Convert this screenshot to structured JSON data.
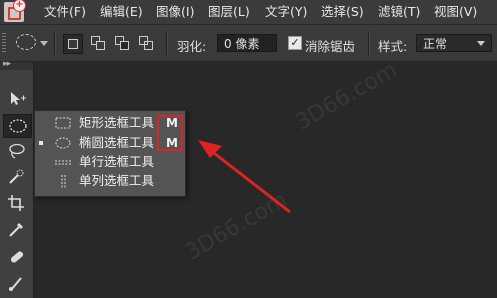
{
  "menubar": {
    "items": [
      "文件(F)",
      "编辑(E)",
      "图像(I)",
      "图层(L)",
      "文字(Y)",
      "选择(S)",
      "滤镜(T)",
      "视图(V)"
    ]
  },
  "options": {
    "feather_label": "羽化:",
    "feather_value": "0 像素",
    "antialias_label": "消除锯齿",
    "antialias_checked": "✓",
    "style_label": "样式:",
    "style_value": "正常"
  },
  "flyout": {
    "items": [
      {
        "label": "矩形选框工具",
        "shortcut": "M",
        "icon": "rect-marquee-icon"
      },
      {
        "label": "椭圆选框工具",
        "shortcut": "M",
        "icon": "ellipse-marquee-icon"
      },
      {
        "label": "单行选框工具",
        "shortcut": "",
        "icon": "single-row-marquee-icon"
      },
      {
        "label": "单列选框工具",
        "shortcut": "",
        "icon": "single-column-marquee-icon"
      }
    ]
  },
  "watermark": "3D66.com",
  "colors": {
    "highlight": "#e02222",
    "panel": "#3a3a3a",
    "canvas": "#282828"
  }
}
